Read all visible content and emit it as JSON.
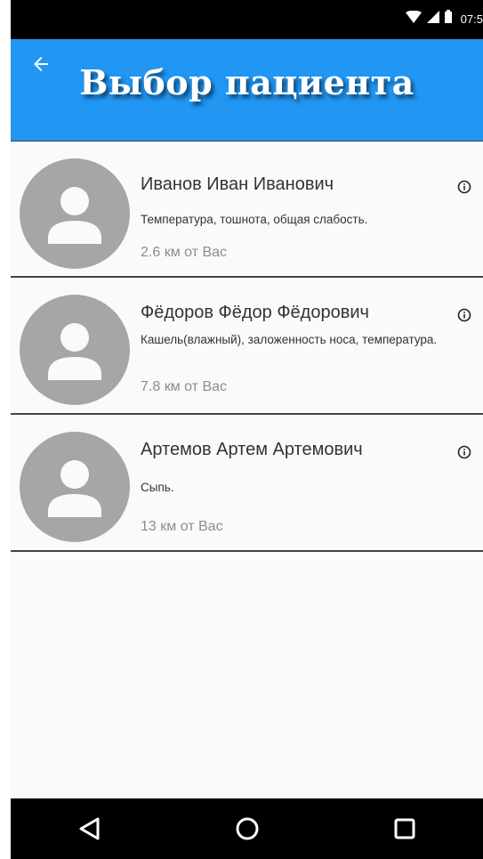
{
  "status_bar": {
    "time": "07:5",
    "icons": [
      "wifi-icon",
      "cell-signal-icon",
      "battery-icon"
    ]
  },
  "app_bar": {
    "title": "Выбор пациента",
    "back_icon": "arrow-back-icon",
    "color": "#2196f3"
  },
  "patients": [
    {
      "name": "Иванов Иван Иванович",
      "symptoms": "Температура, тошнота, общая слабость.",
      "distance": "2.6 км от Вас"
    },
    {
      "name": "Фёдоров Фёдор Фёдорович",
      "symptoms": "Кашель(влажный), заложенность носа, температура.",
      "distance": "7.8 км от Вас"
    },
    {
      "name": "Артемов Артем Артемович",
      "symptoms": "Сыпь.",
      "distance": "13 км от Вас"
    }
  ],
  "nav_bar": {
    "buttons": [
      "back-triangle-icon",
      "home-circle-icon",
      "recents-square-icon"
    ]
  }
}
